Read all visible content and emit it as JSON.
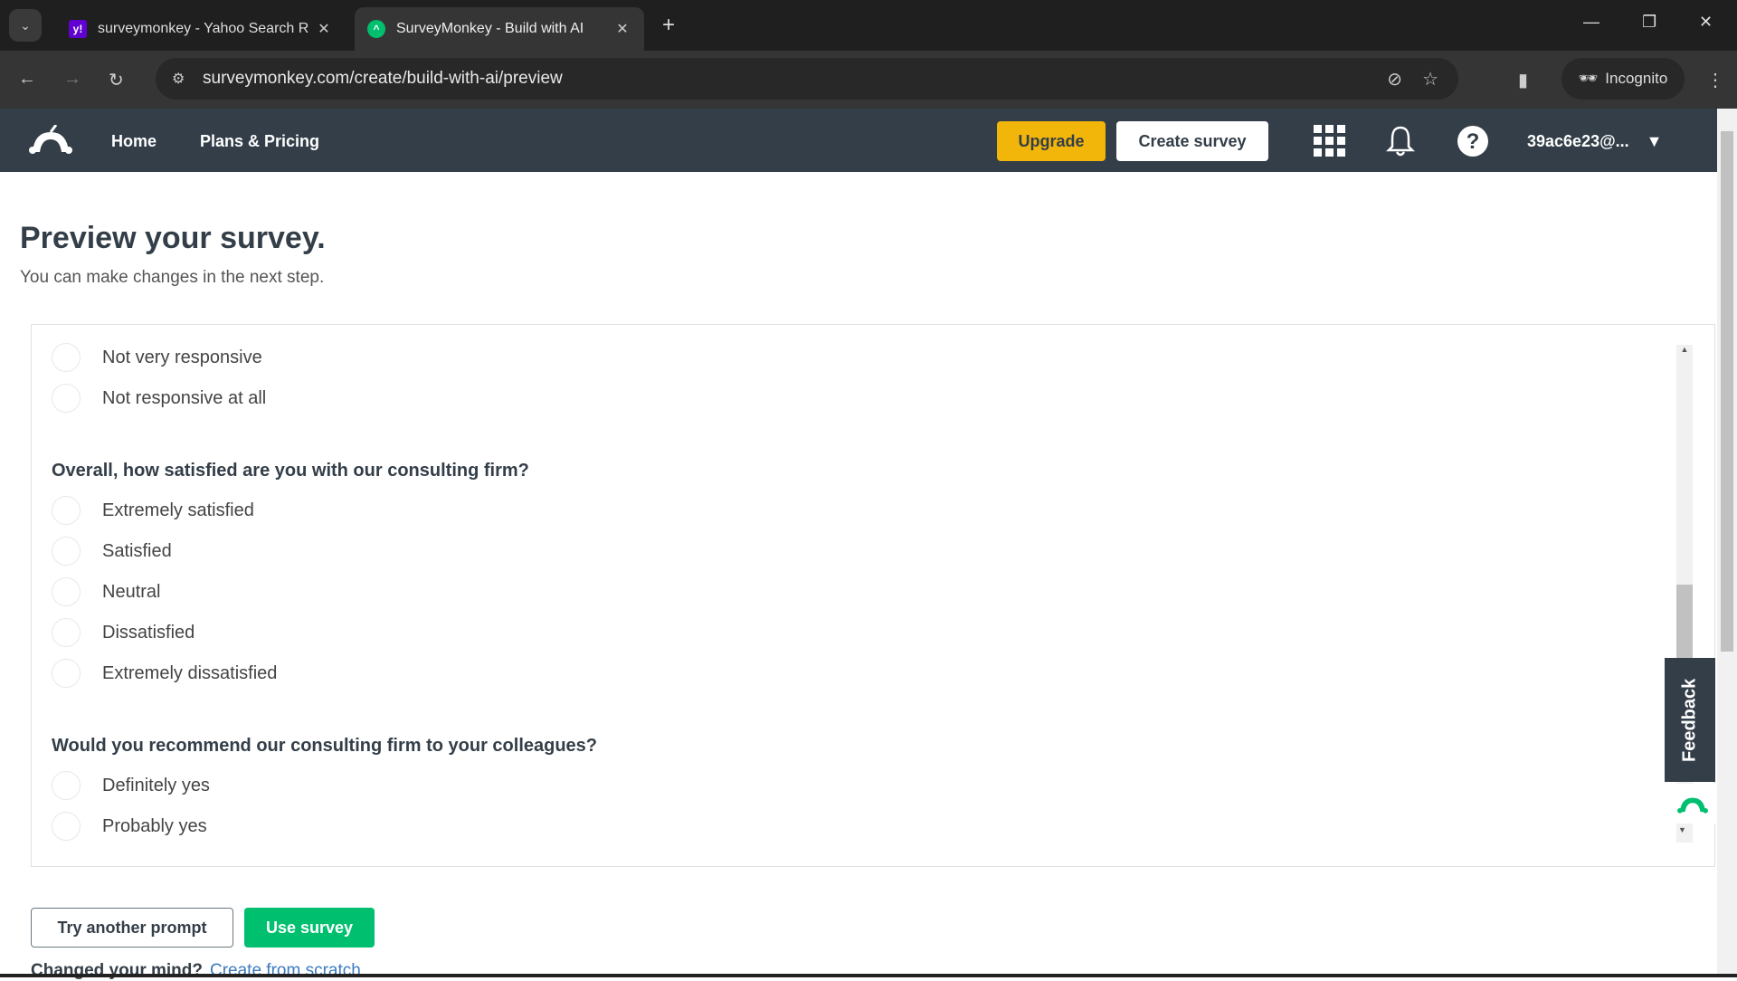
{
  "browser": {
    "tabs": [
      {
        "title": "surveymonkey - Yahoo Search R",
        "favicon": "yahoo-icon",
        "color": "#6001d2"
      },
      {
        "title": "SurveyMonkey - Build with AI",
        "favicon": "surveymonkey-icon",
        "color": "#00bf6f",
        "active": true
      }
    ],
    "url": "surveymonkey.com/create/build-with-ai/preview",
    "incognito_label": "Incognito"
  },
  "topnav": {
    "home": "Home",
    "pricing": "Plans & Pricing",
    "upgrade": "Upgrade",
    "create_survey": "Create survey",
    "account": "39ac6e23@..."
  },
  "page": {
    "title": "Preview your survey.",
    "subtitle": "You can make changes in the next step."
  },
  "survey": {
    "partial_options": [
      "Not very responsive",
      "Not responsive at all"
    ],
    "questions": [
      {
        "text": "Overall, how satisfied are you with our consulting firm?",
        "options": [
          "Extremely satisfied",
          "Satisfied",
          "Neutral",
          "Dissatisfied",
          "Extremely dissatisfied"
        ]
      },
      {
        "text": "Would you recommend our consulting firm to your colleagues?",
        "options": [
          "Definitely yes",
          "Probably yes"
        ]
      }
    ]
  },
  "feedback_label": "Feedback",
  "actions": {
    "try_another": "Try another prompt",
    "use_survey": "Use survey",
    "changed_mind": "Changed your mind?",
    "create_scratch": "Create from scratch"
  },
  "colors": {
    "nav": "#333e48",
    "upgrade": "#f2b50a",
    "accent": "#00bf6f"
  }
}
